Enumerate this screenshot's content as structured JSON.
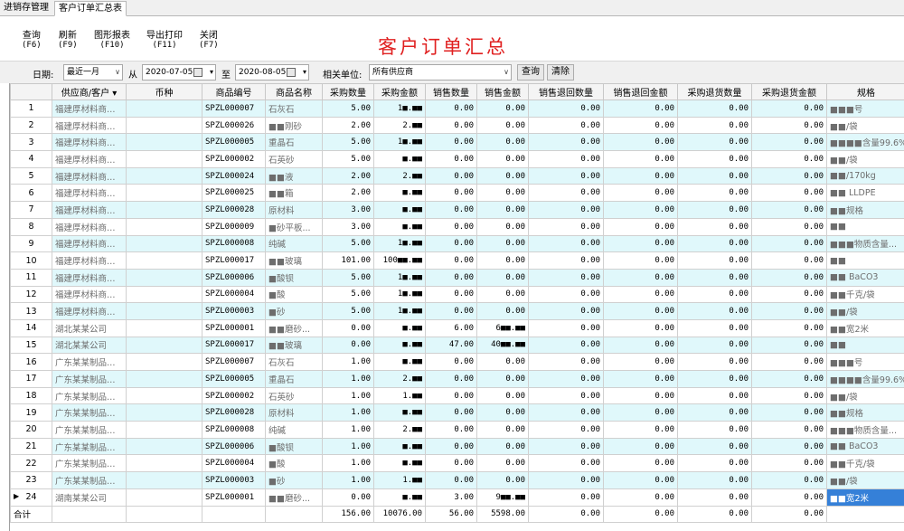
{
  "tabs": [
    "进销存管理",
    "客户订单汇总表"
  ],
  "toolbar": {
    "buttons": [
      {
        "label": "查询",
        "key": "(F6)"
      },
      {
        "label": "刷新",
        "key": "(F9)"
      },
      {
        "label": "图形报表",
        "key": "(F10)"
      },
      {
        "label": "导出打印",
        "key": "(F11)"
      },
      {
        "label": "关闭",
        "key": "(F7)"
      }
    ],
    "title": "客户订单汇总"
  },
  "filters": {
    "date_label": "日期:",
    "period": "最近一月",
    "from_label": "从",
    "from_date": "2020-07-05",
    "to_label": "至",
    "to_date": "2020-08-05",
    "unit_label": "相关单位:",
    "unit_value": "所有供应商",
    "query_btn": "查询",
    "clear_btn": "清除"
  },
  "columns": [
    "",
    "供应商/客户",
    "币种",
    "商品编号",
    "商品名称",
    "采购数量",
    "采购金额",
    "销售数量",
    "销售金额",
    "销售退回数量",
    "销售退回金额",
    "采购退货数量",
    "采购退货金额",
    "规格"
  ],
  "rows": [
    [
      "1",
      "福建厚材料商…",
      "",
      "SPZL000007",
      "石灰石",
      "5.00",
      "1■.■■",
      "0.00",
      "0.00",
      "0.00",
      "0.00",
      "0.00",
      "0.00",
      "■■■号"
    ],
    [
      "2",
      "福建厚材料商…",
      "",
      "SPZL000026",
      "■■刚砂",
      "2.00",
      "2.■■",
      "0.00",
      "0.00",
      "0.00",
      "0.00",
      "0.00",
      "0.00",
      "■■/袋"
    ],
    [
      "3",
      "福建厚材料商…",
      "",
      "SPZL000005",
      "重晶石",
      "5.00",
      "1■.■■",
      "0.00",
      "0.00",
      "0.00",
      "0.00",
      "0.00",
      "0.00",
      "■■■■含量99.6%"
    ],
    [
      "4",
      "福建厚材料商…",
      "",
      "SPZL000002",
      "石英砂",
      "5.00",
      "■.■■",
      "0.00",
      "0.00",
      "0.00",
      "0.00",
      "0.00",
      "0.00",
      "■■/袋"
    ],
    [
      "5",
      "福建厚材料商…",
      "",
      "SPZL000024",
      "■■液",
      "2.00",
      "2.■■",
      "0.00",
      "0.00",
      "0.00",
      "0.00",
      "0.00",
      "0.00",
      "■■/170kg"
    ],
    [
      "6",
      "福建厚材料商…",
      "",
      "SPZL000025",
      "■■箱",
      "2.00",
      "■.■■",
      "0.00",
      "0.00",
      "0.00",
      "0.00",
      "0.00",
      "0.00",
      "■■ LLDPE"
    ],
    [
      "7",
      "福建厚材料商…",
      "",
      "SPZL000028",
      "原材料",
      "3.00",
      "■.■■",
      "0.00",
      "0.00",
      "0.00",
      "0.00",
      "0.00",
      "0.00",
      "■■规格"
    ],
    [
      "8",
      "福建厚材料商…",
      "",
      "SPZL000009",
      "■砂平板...",
      "3.00",
      "■.■■",
      "0.00",
      "0.00",
      "0.00",
      "0.00",
      "0.00",
      "0.00",
      "■■"
    ],
    [
      "9",
      "福建厚材料商…",
      "",
      "SPZL000008",
      "纯碱",
      "5.00",
      "1■.■■",
      "0.00",
      "0.00",
      "0.00",
      "0.00",
      "0.00",
      "0.00",
      "■■■物质含量..."
    ],
    [
      "10",
      "福建厚材料商…",
      "",
      "SPZL000017",
      "■■玻璃",
      "101.00",
      "100■■.■■",
      "0.00",
      "0.00",
      "0.00",
      "0.00",
      "0.00",
      "0.00",
      "■■"
    ],
    [
      "11",
      "福建厚材料商…",
      "",
      "SPZL000006",
      "■酸钡",
      "5.00",
      "1■.■■",
      "0.00",
      "0.00",
      "0.00",
      "0.00",
      "0.00",
      "0.00",
      "■■ BaCO3"
    ],
    [
      "12",
      "福建厚材料商…",
      "",
      "SPZL000004",
      "■酸",
      "5.00",
      "1■.■■",
      "0.00",
      "0.00",
      "0.00",
      "0.00",
      "0.00",
      "0.00",
      "■■千克/袋"
    ],
    [
      "13",
      "福建厚材料商…",
      "",
      "SPZL000003",
      "■砂",
      "5.00",
      "1■.■■",
      "0.00",
      "0.00",
      "0.00",
      "0.00",
      "0.00",
      "0.00",
      "■■/袋"
    ],
    [
      "14",
      "湖北某某公司",
      "",
      "SPZL000001",
      "■■磨砂...",
      "0.00",
      "■.■■",
      "6.00",
      "6■■.■■",
      "0.00",
      "0.00",
      "0.00",
      "0.00",
      "■■宽2米"
    ],
    [
      "15",
      "湖北某某公司",
      "",
      "SPZL000017",
      "■■玻璃",
      "0.00",
      "■.■■",
      "47.00",
      "40■■.■■",
      "0.00",
      "0.00",
      "0.00",
      "0.00",
      "■■"
    ],
    [
      "16",
      "广东某某制品…",
      "",
      "SPZL000007",
      "石灰石",
      "1.00",
      "■.■■",
      "0.00",
      "0.00",
      "0.00",
      "0.00",
      "0.00",
      "0.00",
      "■■■号"
    ],
    [
      "17",
      "广东某某制品…",
      "",
      "SPZL000005",
      "重晶石",
      "1.00",
      "2.■■",
      "0.00",
      "0.00",
      "0.00",
      "0.00",
      "0.00",
      "0.00",
      "■■■■含量99.6%"
    ],
    [
      "18",
      "广东某某制品…",
      "",
      "SPZL000002",
      "石英砂",
      "1.00",
      "1.■■",
      "0.00",
      "0.00",
      "0.00",
      "0.00",
      "0.00",
      "0.00",
      "■■/袋"
    ],
    [
      "19",
      "广东某某制品…",
      "",
      "SPZL000028",
      "原材料",
      "1.00",
      "■.■■",
      "0.00",
      "0.00",
      "0.00",
      "0.00",
      "0.00",
      "0.00",
      "■■规格"
    ],
    [
      "20",
      "广东某某制品…",
      "",
      "SPZL000008",
      "纯碱",
      "1.00",
      "2.■■",
      "0.00",
      "0.00",
      "0.00",
      "0.00",
      "0.00",
      "0.00",
      "■■■物质含量..."
    ],
    [
      "21",
      "广东某某制品…",
      "",
      "SPZL000006",
      "■酸钡",
      "1.00",
      "■.■■",
      "0.00",
      "0.00",
      "0.00",
      "0.00",
      "0.00",
      "0.00",
      "■■ BaCO3"
    ],
    [
      "22",
      "广东某某制品…",
      "",
      "SPZL000004",
      "■酸",
      "1.00",
      "■.■■",
      "0.00",
      "0.00",
      "0.00",
      "0.00",
      "0.00",
      "0.00",
      "■■千克/袋"
    ],
    [
      "23",
      "广东某某制品…",
      "",
      "SPZL000003",
      "■砂",
      "1.00",
      "1.■■",
      "0.00",
      "0.00",
      "0.00",
      "0.00",
      "0.00",
      "0.00",
      "■■/袋"
    ],
    [
      "24",
      "湖南某某公司",
      "",
      "SPZL000001",
      "■■磨砂...",
      "0.00",
      "■.■■",
      "3.00",
      "9■■.■■",
      "0.00",
      "0.00",
      "0.00",
      "0.00",
      "■■宽2米"
    ]
  ],
  "totals": [
    "合计",
    "",
    "",
    "",
    "",
    "156.00",
    "10076.00",
    "56.00",
    "5598.00",
    "0.00",
    "0.00",
    "0.00",
    "0.00",
    ""
  ]
}
